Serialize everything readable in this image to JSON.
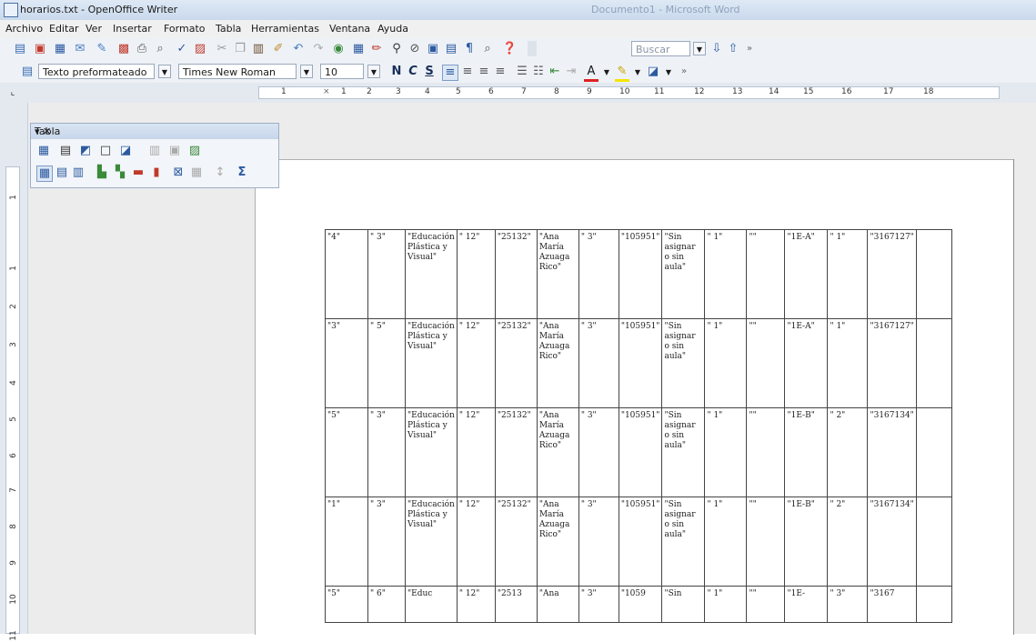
{
  "window": {
    "title": "horarios.txt - OpenOffice Writer",
    "background_title": "Documento1 - Microsoft Word"
  },
  "menu": [
    "Archivo",
    "Editar",
    "Ver",
    "Insertar",
    "Formato",
    "Tabla",
    "Herramientas",
    "Ventana",
    "Ayuda"
  ],
  "toolbar": {
    "search_placeholder": "Buscar",
    "style_value": "Texto preformateado",
    "font_value": "Times New Roman",
    "size_value": "10",
    "bold": "N",
    "italic": "C",
    "underline": "S"
  },
  "ruler": {
    "h_labels": [
      "1",
      "2",
      "3",
      "4",
      "5",
      "6",
      "7",
      "8",
      "9",
      "10",
      "11",
      "12",
      "13",
      "14",
      "15",
      "16",
      "17",
      "18"
    ],
    "v_labels": [
      "1",
      "1",
      "2",
      "3",
      "4",
      "5",
      "6",
      "7",
      "8",
      "9",
      "10",
      "11"
    ]
  },
  "table_palette": {
    "title": "Tabla"
  },
  "document": {
    "columns": [
      {
        "w": 47
      },
      {
        "w": 41
      },
      {
        "w": 47
      },
      {
        "w": 42
      },
      {
        "w": 46
      },
      {
        "w": 46
      },
      {
        "w": 44
      },
      {
        "w": 42
      },
      {
        "w": 47
      },
      {
        "w": 46
      },
      {
        "w": 42
      },
      {
        "w": 47
      },
      {
        "w": 44
      },
      {
        "w": 46
      },
      {
        "w": 39
      }
    ],
    "rows": [
      {
        "cells": [
          "\"4\"",
          "\" 3\"",
          "\"Educación Plástica y Visual\"",
          "\" 12\"",
          "\"25132\"",
          "\"Ana María Azuaga Rico\"",
          "\" 3\"",
          "\"105951\"",
          "\"Sin asignar o sin aula\"",
          "\" 1\"",
          "\"\"",
          "\"1E-A\"",
          "\" 1\"",
          "\"3167127\"",
          ""
        ]
      },
      {
        "cells": [
          "\"3\"",
          "\" 5\"",
          "\"Educación Plástica y Visual\"",
          "\" 12\"",
          "\"25132\"",
          "\"Ana María Azuaga Rico\"",
          "\" 3\"",
          "\"105951\"",
          "\"Sin asignar o sin aula\"",
          "\" 1\"",
          "\"\"",
          "\"1E-A\"",
          "\" 1\"",
          "\"3167127\"",
          ""
        ]
      },
      {
        "cells": [
          "\"5\"",
          "\" 3\"",
          "\"Educación Plástica y Visual\"",
          "\" 12\"",
          "\"25132\"",
          "\"Ana María Azuaga Rico\"",
          "\" 3\"",
          "\"105951\"",
          "\"Sin asignar o sin aula\"",
          "\" 1\"",
          "\"\"",
          "\"1E-B\"",
          "\" 2\"",
          "\"3167134\"",
          ""
        ]
      },
      {
        "cells": [
          "\"1\"",
          "\" 3\"",
          "\"Educación Plástica y Visual\"",
          "\" 12\"",
          "\"25132\"",
          "\"Ana María Azuaga Rico\"",
          "\" 3\"",
          "\"105951\"",
          "\"Sin asignar o sin aula\"",
          "\" 1\"",
          "\"\"",
          "\"1E-B\"",
          "\" 2\"",
          "\"3167134\"",
          ""
        ]
      },
      {
        "cells": [
          "\"5\"",
          "\" 6\"",
          "\"Educ",
          "\" 12\"",
          "\"2513",
          "\"Ana",
          "\" 3\"",
          "\"1059",
          "\"Sin",
          "\" 1\"",
          "\"\"",
          "\"1E-",
          "\" 3\"",
          "\"3167",
          ""
        ]
      }
    ]
  }
}
